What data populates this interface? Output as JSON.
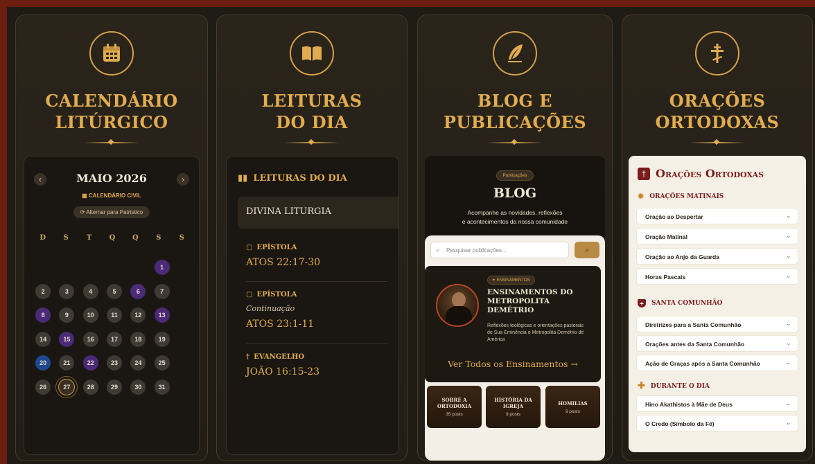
{
  "colors": {
    "frame": "#6e1e10",
    "gold": "#e1ac4f",
    "purple": "#4b2a78",
    "blue": "#1d4a8f",
    "crimson": "#7a1d1d"
  },
  "cards": [
    {
      "icon": "calendar-icon",
      "title_lines": [
        "CALENDÁRIO",
        "LITÚRGICO"
      ]
    },
    {
      "icon": "book-icon",
      "title_lines": [
        "LEITURAS",
        "DO DIA"
      ]
    },
    {
      "icon": "quill-icon",
      "title_lines": [
        "BLOG E",
        "PUBLICAÇÕES"
      ]
    },
    {
      "icon": "orthodox-cross-icon",
      "title_lines": [
        "ORAÇÕES",
        "ORTODOXAS"
      ]
    }
  ],
  "calendar": {
    "month": "MAIO 2026",
    "prev": "‹",
    "next": "›",
    "mode": "CALENDÁRIO CIVIL",
    "toggle": "Alternar para Patrístico",
    "weekdays": [
      "D",
      "S",
      "T",
      "Q",
      "Q",
      "S",
      "S"
    ],
    "leading_blanks": 5,
    "days": [
      {
        "n": "1",
        "t": "purple"
      },
      {
        "n": "2",
        "t": ""
      },
      {
        "n": "3",
        "t": ""
      },
      {
        "n": "4",
        "t": ""
      },
      {
        "n": "5",
        "t": ""
      },
      {
        "n": "6",
        "t": "purple"
      },
      {
        "n": "7",
        "t": ""
      },
      {
        "n": "8",
        "t": "purple"
      },
      {
        "n": "9",
        "t": ""
      },
      {
        "n": "10",
        "t": ""
      },
      {
        "n": "11",
        "t": ""
      },
      {
        "n": "12",
        "t": ""
      },
      {
        "n": "13",
        "t": "purple"
      },
      {
        "n": "14",
        "t": ""
      },
      {
        "n": "15",
        "t": "purple"
      },
      {
        "n": "16",
        "t": ""
      },
      {
        "n": "17",
        "t": ""
      },
      {
        "n": "18",
        "t": ""
      },
      {
        "n": "19",
        "t": ""
      },
      {
        "n": "20",
        "t": "blue"
      },
      {
        "n": "21",
        "t": ""
      },
      {
        "n": "22",
        "t": "purple"
      },
      {
        "n": "23",
        "t": ""
      },
      {
        "n": "24",
        "t": ""
      },
      {
        "n": "25",
        "t": ""
      },
      {
        "n": "26",
        "t": ""
      },
      {
        "n": "27",
        "t": "sel"
      },
      {
        "n": "28",
        "t": ""
      },
      {
        "n": "29",
        "t": ""
      },
      {
        "n": "30",
        "t": ""
      },
      {
        "n": "31",
        "t": ""
      }
    ]
  },
  "readings": {
    "header": "LEITURAS DO DIA",
    "service": "DIVINA LITURGIA",
    "items": [
      {
        "label": "EPÍSTOLA",
        "sub": "",
        "ref": "ATOS 22:17-30"
      },
      {
        "label": "EPÍSTOLA",
        "sub": "Continuação",
        "ref": "ATOS 23:1-11"
      },
      {
        "label": "EVANGELHO",
        "sub": "",
        "ref": "JOÃO 16:15-23"
      }
    ]
  },
  "blog": {
    "pill": "Publicações",
    "title": "BLOG",
    "desc1": "Acompanhe as novidades, reflexões",
    "desc2": "e acontecimentos da nossa comunidade",
    "search_placeholder": "Pesquisar publicações...",
    "featured": {
      "pill": "✦ ENSINAMENTOS",
      "title": "ENSINAMENTOS DO METROPOLITA DEMÉTRIO",
      "desc": "Reflexões teológicas e orientações pastorais de Sua Eminência o Metropolita Demétrio de América",
      "link": "Ver Todos os Ensinamentos →"
    },
    "categories": [
      {
        "title": "SOBRE A ORTODOXIA",
        "count": "35 posts"
      },
      {
        "title": "HISTÓRIA DA IGREJA",
        "count": "9 posts"
      },
      {
        "title": "HOMILIAS",
        "count": "9 posts"
      }
    ]
  },
  "prayers": {
    "title": "Orações Ortodoxas",
    "sections": [
      {
        "icon": "sun-icon",
        "label": "ORAÇÕES MATINAIS",
        "items": [
          "Oração ao Despertar",
          "Oração Matinal",
          "Oração ao Anjo da Guarda",
          "Horas Pascais"
        ]
      },
      {
        "icon": "shield-cross-icon",
        "label": "SANTA COMUNHÃO",
        "items": [
          "Diretrizes para a Santa Comunhão",
          "Orações antes da Santa Comunhão",
          "Ação de Graças após a Santa Comunhão"
        ]
      },
      {
        "icon": "cross-icon",
        "label": "DURANTE O DIA",
        "items": [
          "Hino Akathistos à Mãe de Deus",
          "O Credo (Símbolo da Fé)"
        ]
      }
    ]
  }
}
